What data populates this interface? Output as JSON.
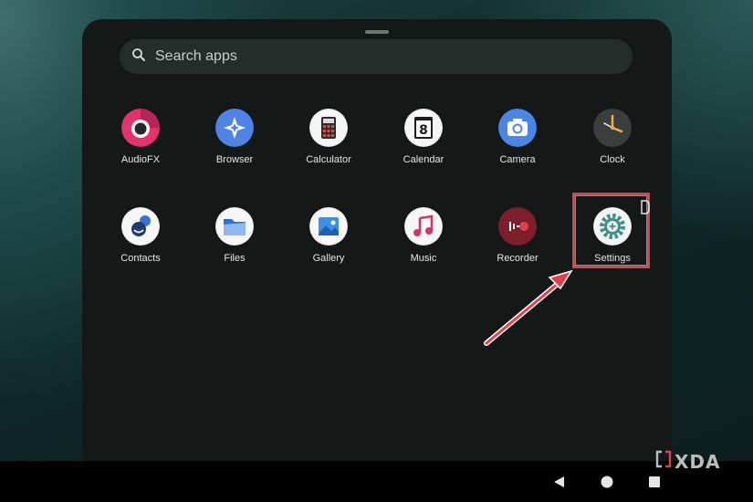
{
  "search": {
    "placeholder": "Search apps",
    "icon": "search-icon"
  },
  "apps": [
    {
      "label": "AudioFX",
      "icon": "audiofx-icon"
    },
    {
      "label": "Browser",
      "icon": "browser-icon"
    },
    {
      "label": "Calculator",
      "icon": "calculator-icon"
    },
    {
      "label": "Calendar",
      "icon": "calendar-icon",
      "day": "8"
    },
    {
      "label": "Camera",
      "icon": "camera-icon"
    },
    {
      "label": "Clock",
      "icon": "clock-icon"
    },
    {
      "label": "Contacts",
      "icon": "contacts-icon"
    },
    {
      "label": "Files",
      "icon": "files-icon"
    },
    {
      "label": "Gallery",
      "icon": "gallery-icon"
    },
    {
      "label": "Music",
      "icon": "music-icon"
    },
    {
      "label": "Recorder",
      "icon": "recorder-icon"
    },
    {
      "label": "Settings",
      "icon": "settings-icon"
    }
  ],
  "annotation": {
    "highlight_color": "#e0404c",
    "target": "Settings"
  },
  "nav": {
    "back": "back-icon",
    "home": "home-icon",
    "recents": "recents-icon"
  },
  "watermark": {
    "text": "XDA"
  }
}
